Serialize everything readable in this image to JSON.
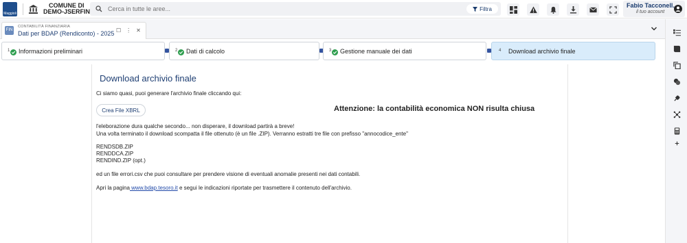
{
  "header": {
    "logo_text": "Maggioli",
    "municipality": [
      "COMUNE DI",
      "DEMO-JSERFIN"
    ],
    "search_placeholder": "Cerca in tutte le aree...",
    "filter_label": "Filtra",
    "user_name": "Fabio Tacconell...",
    "user_subtitle": "il tuo account"
  },
  "tab": {
    "prefix": "CONTABILITÀ FINANZIARIA",
    "title": "Dati per BDAP (Rendiconto) - 2025",
    "icon_text": "FIN"
  },
  "steps": [
    {
      "num": "1",
      "label": "Informazioni preliminari",
      "done": true
    },
    {
      "num": "2",
      "label": "Dati di calcolo",
      "done": true
    },
    {
      "num": "3",
      "label": "Gestione manuale dei dati",
      "done": true
    },
    {
      "num": "4",
      "label": "Download archivio finale",
      "active": true
    }
  ],
  "content": {
    "title": "Download archivio finale",
    "intro": "Ci siamo quasi, puoi generare l'archivio finale cliccando qui:",
    "create_button": "Crea File XBRL",
    "warning": "Attenzione: la contabilità economica NON risulta chiusa",
    "info_line1": "l'eleborazione dura qualche secondo... non disperare, il download partirà a breve!",
    "info_line2": "Una volta terminato il download scompatta il file ottenuto (è un file .ZIP). Verranno estratti tre file con prefisso \"annocodice_ente\"",
    "files": [
      "RENDSDB.ZIP",
      "RENDDCA.ZIP",
      "RENDIND.ZIP (opt.)"
    ],
    "errors_line": "ed un file errori.csv che puoi consultare per prendere visione di eventuali anomalie presenti nei dati contabili.",
    "link_before": "Apri la pagina",
    "link_text": " www.bdap.tesoro.it",
    "link_after": " e segui le indicazioni riportate per trasmettere il contenuto dell'archivio."
  },
  "colors": {
    "accent": "#1f3f73",
    "active_step_bg": "#d9ecfb",
    "step_done": "#2e9e4f",
    "step_connector": "#3454a0"
  }
}
